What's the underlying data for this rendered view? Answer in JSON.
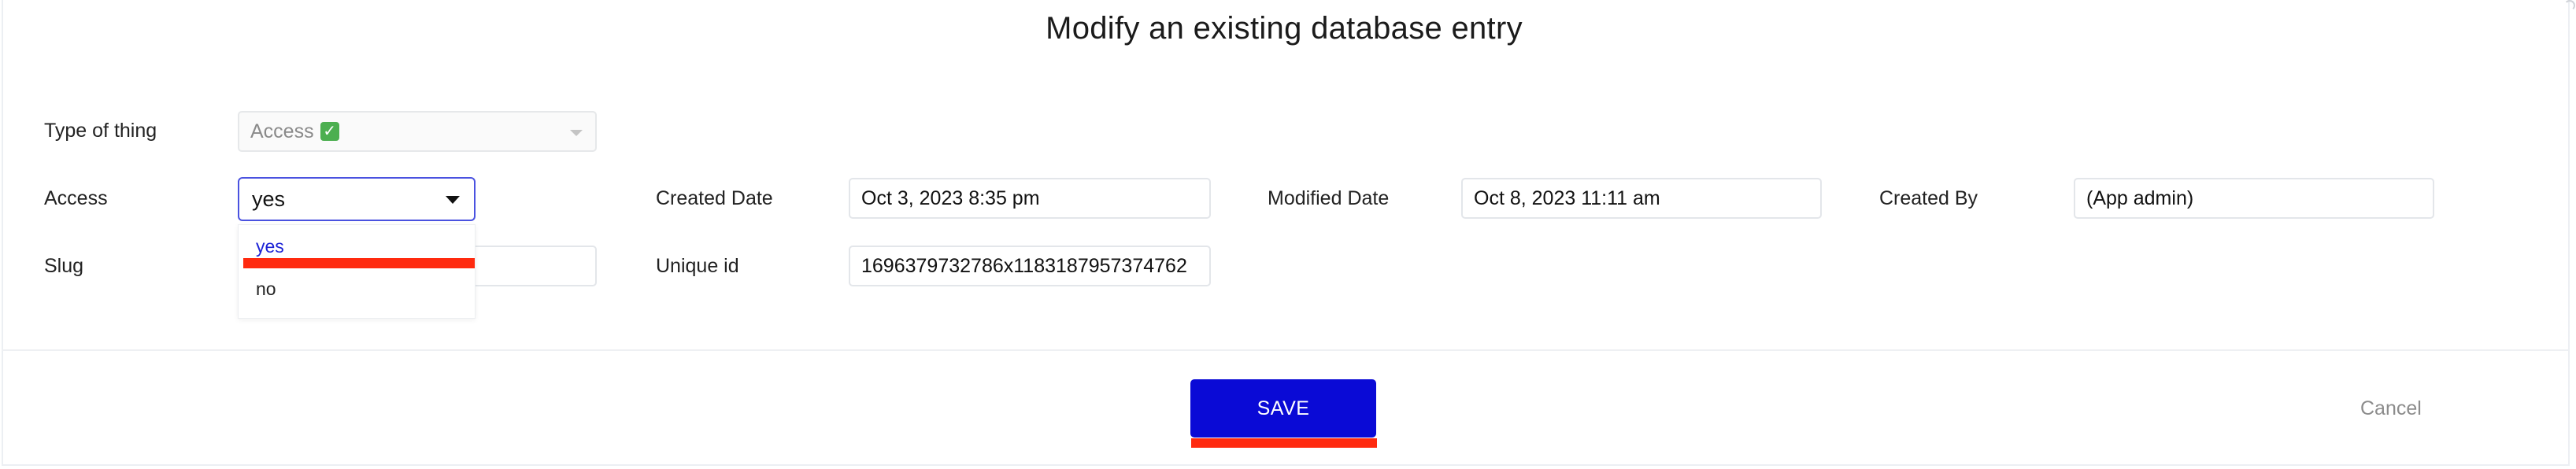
{
  "title": "Modify an existing database entry",
  "fields": {
    "type_of_thing": {
      "label": "Type of thing",
      "value": "Access",
      "icon": "check-mark-icon"
    },
    "access": {
      "label": "Access",
      "value": "yes",
      "options": [
        "yes",
        "no"
      ]
    },
    "slug": {
      "label": "Slug",
      "value": ""
    },
    "created_date": {
      "label": "Created Date",
      "value": "Oct 3, 2023 8:35 pm"
    },
    "modified_date": {
      "label": "Modified Date",
      "value": "Oct 8, 2023 11:11 am"
    },
    "created_by": {
      "label": "Created By",
      "value": "(App admin)"
    },
    "unique_id": {
      "label": "Unique id",
      "value": "1696379732786x1183187957374762"
    }
  },
  "buttons": {
    "save": "SAVE",
    "cancel": "Cancel"
  },
  "colors": {
    "accent": "#0a0ad6",
    "highlight": "#ff2a0f",
    "selected_option": "#1b22d6"
  }
}
